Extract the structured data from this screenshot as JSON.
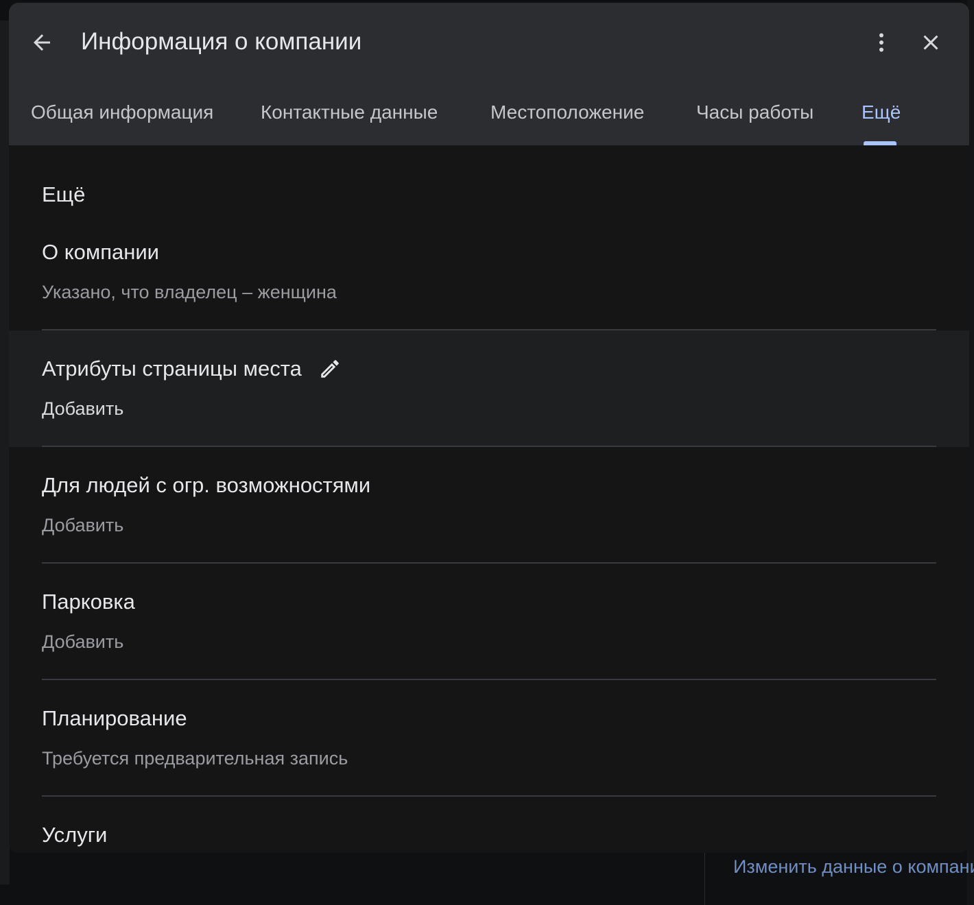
{
  "dialog": {
    "title": "Информация о компании",
    "icons": {
      "back": "arrow-back-icon",
      "more": "more-vertical-icon",
      "close": "close-icon",
      "edit": "pencil-icon"
    }
  },
  "tabs": [
    {
      "label": "Общая информация",
      "active": false
    },
    {
      "label": "Контактные данные",
      "active": false
    },
    {
      "label": "Местоположение",
      "active": false
    },
    {
      "label": "Часы работы",
      "active": false
    },
    {
      "label": "Ещё",
      "active": true
    }
  ],
  "section": {
    "heading": "Ещё",
    "rows": [
      {
        "title": "О компании",
        "subtitle": "Указано, что владелец – женщина"
      },
      {
        "title": "Атрибуты страницы места",
        "subtitle": "Добавить"
      },
      {
        "title": "Для людей с огр. возможностями",
        "subtitle": "Добавить"
      },
      {
        "title": "Парковка",
        "subtitle": "Добавить"
      },
      {
        "title": "Планирование",
        "subtitle": "Требуется предварительная запись"
      },
      {
        "title": "Услуги",
        "subtitle": ""
      }
    ]
  },
  "background": {
    "link": "Изменить данные о компании"
  },
  "colors": {
    "accent": "#a8c4f8",
    "header_bg": "#2c2d31",
    "dialog_bg": "#151516",
    "highlight_row_bg": "#1e1f21",
    "text_primary": "#e6e7ea",
    "text_secondary": "#9a9ca1"
  }
}
